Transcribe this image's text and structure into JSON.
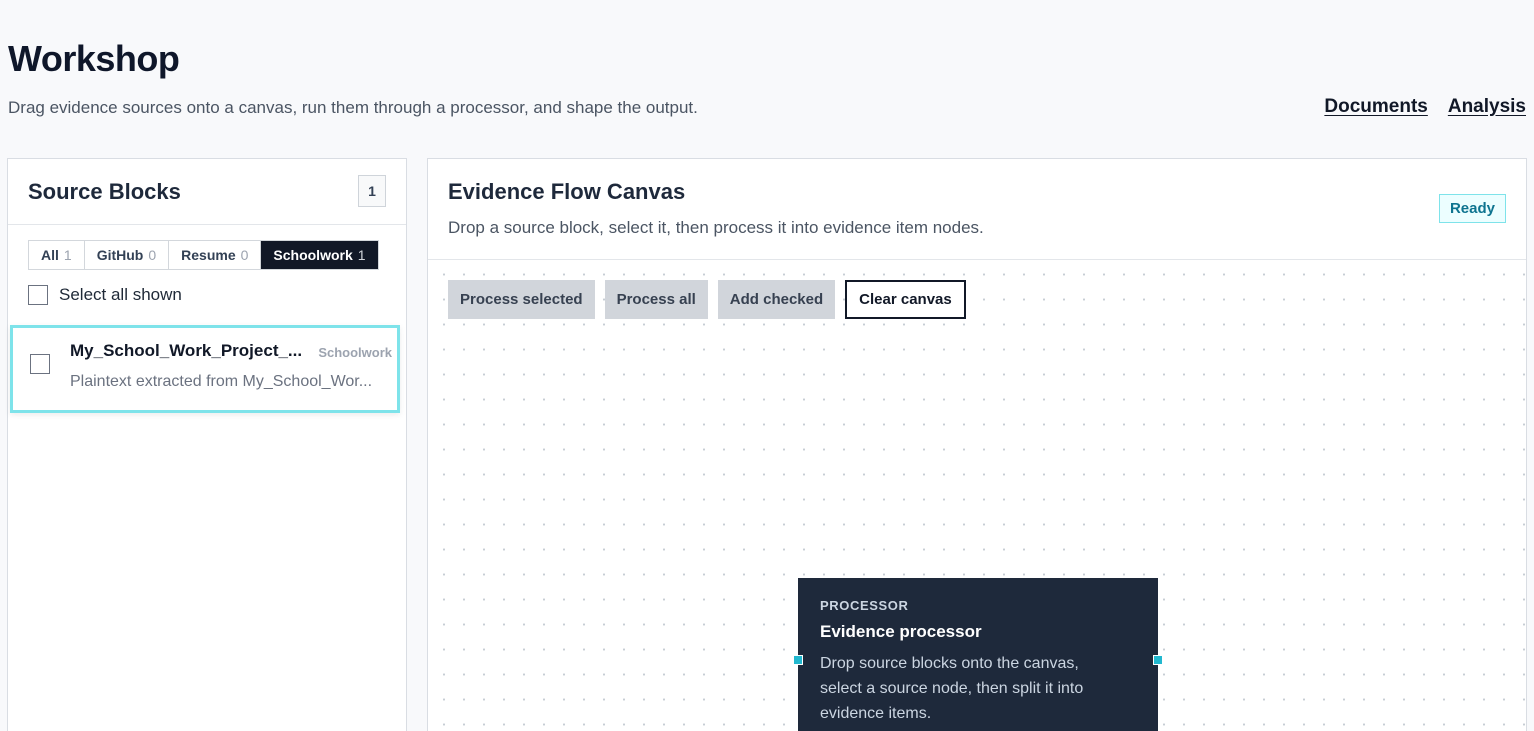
{
  "page": {
    "title": "Workshop",
    "subtitle": "Drag evidence sources onto a canvas, run them through a processor, and shape the output."
  },
  "nav": {
    "documents": "Documents",
    "analysis": "Analysis"
  },
  "source_blocks": {
    "title": "Source Blocks",
    "count": "1",
    "tabs": [
      {
        "label": "All",
        "count": "1",
        "active": false
      },
      {
        "label": "GitHub",
        "count": "0",
        "active": false
      },
      {
        "label": "Resume",
        "count": "0",
        "active": false
      },
      {
        "label": "Schoolwork",
        "count": "1",
        "active": true
      }
    ],
    "select_all_label": "Select all shown",
    "items": [
      {
        "name": "My_School_Work_Project_...",
        "tag": "Schoolwork",
        "description": "Plaintext extracted from My_School_Wor..."
      }
    ]
  },
  "canvas": {
    "title": "Evidence Flow Canvas",
    "subtitle": "Drop a source block, select it, then process it into evidence item nodes.",
    "status": "Ready",
    "toolbar": {
      "process_selected": "Process selected",
      "process_all": "Process all",
      "add_checked": "Add checked",
      "clear_canvas": "Clear canvas"
    },
    "processor": {
      "kicker": "PROCESSOR",
      "title": "Evidence processor",
      "description": "Drop source blocks onto the canvas, select a source node, then split it into evidence items."
    }
  },
  "colors": {
    "accent": "#22b8cf",
    "selection_border": "#7ee3ea",
    "processor_bg": "#1e293b",
    "active_tab_bg": "#111827"
  }
}
